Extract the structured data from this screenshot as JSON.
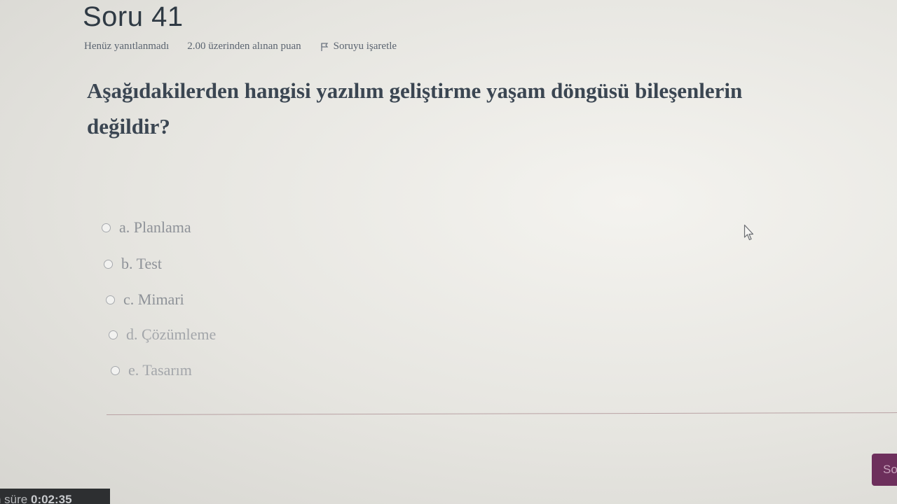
{
  "question": {
    "title": "Soru 41",
    "state": "Henüz yanıtlanmadı",
    "grade": "2.00 üzerinden alınan puan",
    "flag_label": "Soruyu işaretle",
    "text_line1": "Aşağıdakilerden hangisi yazılım geliştirme yaşam döngüsü bileşenlerin",
    "text_line2": "değildir?"
  },
  "answers": [
    {
      "label": "a. Planlama",
      "selected": false
    },
    {
      "label": "b. Test",
      "selected": false
    },
    {
      "label": "c. Mimari",
      "selected": false
    },
    {
      "label": "d. Çözümleme",
      "selected": false
    },
    {
      "label": "e. Tasarım",
      "selected": false
    }
  ],
  "navigation": {
    "next_label": "So"
  },
  "timer": {
    "label": "n süre",
    "time": "0:02:35"
  },
  "icons": {
    "flag": "flag-icon",
    "cursor": "mouse-pointer-icon"
  },
  "colors": {
    "accent": "#6d2f5c",
    "timer_bg": "#2d2f31",
    "divider": "#b9a2a4"
  }
}
